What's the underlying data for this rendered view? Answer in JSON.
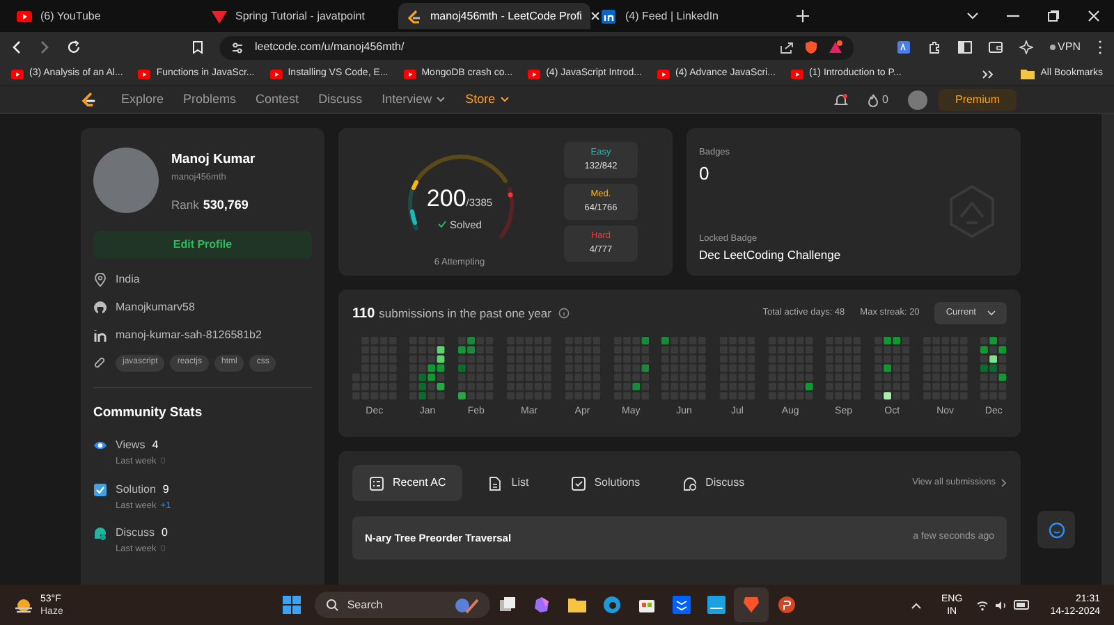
{
  "browser": {
    "tabs": [
      {
        "title": "(6) YouTube",
        "selected": false,
        "kind": "youtube"
      },
      {
        "title": "Spring Tutorial - javatpoint",
        "selected": false,
        "kind": "javatpoint"
      },
      {
        "title": "manoj456mth - LeetCode Profi",
        "selected": true,
        "kind": "leetcode"
      },
      {
        "title": "(4) Feed | LinkedIn",
        "selected": false,
        "kind": "linkedin"
      }
    ],
    "address": "leetcode.com/u/manoj456mth/",
    "vpn": "VPN",
    "bookmarks": [
      "(3) Analysis of an Al...",
      "Functions in JavaScr...",
      "Installing VS Code, E...",
      "MongoDB crash co...",
      "(4) JavaScript Introd...",
      "(4) Advance JavaScri...",
      "(1) Introduction to P..."
    ],
    "all_bookmarks": "All Bookmarks"
  },
  "nav": {
    "items": [
      {
        "label": "Explore",
        "kind": "link"
      },
      {
        "label": "Problems",
        "kind": "link"
      },
      {
        "label": "Contest",
        "kind": "link"
      },
      {
        "label": "Discuss",
        "kind": "link"
      },
      {
        "label": "Interview",
        "kind": "menu"
      },
      {
        "label": "Store",
        "kind": "store"
      }
    ],
    "fire_count": "0",
    "premium": "Premium"
  },
  "profile": {
    "name": "Manoj Kumar",
    "username": "manoj456mth",
    "rank_label": "Rank",
    "rank": "530,769",
    "edit": "Edit Profile",
    "details": [
      {
        "kind": "location",
        "text": "India"
      },
      {
        "kind": "github",
        "text": "Manojkumarv58"
      },
      {
        "kind": "linkedin",
        "text": "manoj-kumar-sah-8126581b2"
      }
    ],
    "skills": [
      "javascript",
      "reactjs",
      "html",
      "css"
    ],
    "community_title": "Community Stats",
    "stats": [
      {
        "kind": "views",
        "label": "Views",
        "value": "4",
        "last_week_label": "Last week",
        "last_week": "0"
      },
      {
        "kind": "solution",
        "label": "Solution",
        "value": "9",
        "last_week_label": "Last week",
        "last_week": "+1"
      },
      {
        "kind": "discuss",
        "label": "Discuss",
        "value": "0",
        "last_week_label": "Last week",
        "last_week": "0"
      }
    ]
  },
  "solved": {
    "count": "200",
    "total": "/3385",
    "label": "Solved",
    "attempting": "6 Attempting",
    "difficulties": [
      {
        "label": "Easy",
        "value": "132/842",
        "color": "#1cbaba"
      },
      {
        "label": "Med.",
        "value": "64/1766",
        "color": "#ffb700"
      },
      {
        "label": "Hard",
        "value": "4/777",
        "color": "#f63737"
      }
    ]
  },
  "badges": {
    "title": "Badges",
    "count": "0",
    "locked_label": "Locked Badge",
    "locked_name": "Dec LeetCoding Challenge"
  },
  "submissions": {
    "count": "110",
    "text": "submissions in the past one year",
    "active_days": "Total active days: 48",
    "max_streak": "Max streak: 20",
    "dropdown": "Current",
    "months": [
      "Dec",
      "Jan",
      "Feb",
      "Mar",
      "Apr",
      "May",
      "Jun",
      "Jul",
      "Aug",
      "Sep",
      "Oct",
      "Nov",
      "Dec"
    ]
  },
  "recent": {
    "tabs": [
      {
        "label": "Recent AC",
        "kind": "recent",
        "selected": true
      },
      {
        "label": "List",
        "kind": "list",
        "selected": false
      },
      {
        "label": "Solutions",
        "kind": "solutions",
        "selected": false
      },
      {
        "label": "Discuss",
        "kind": "discuss",
        "selected": false
      }
    ],
    "view_all": "View all submissions",
    "items": [
      {
        "title": "N-ary Tree Preorder Traversal",
        "time": "a few seconds ago"
      }
    ]
  },
  "taskbar": {
    "temperature": "53°F",
    "condition": "Haze",
    "search": "Search",
    "language": "ENG",
    "region": "IN",
    "time": "21:31",
    "date": "14-12-2024"
  }
}
